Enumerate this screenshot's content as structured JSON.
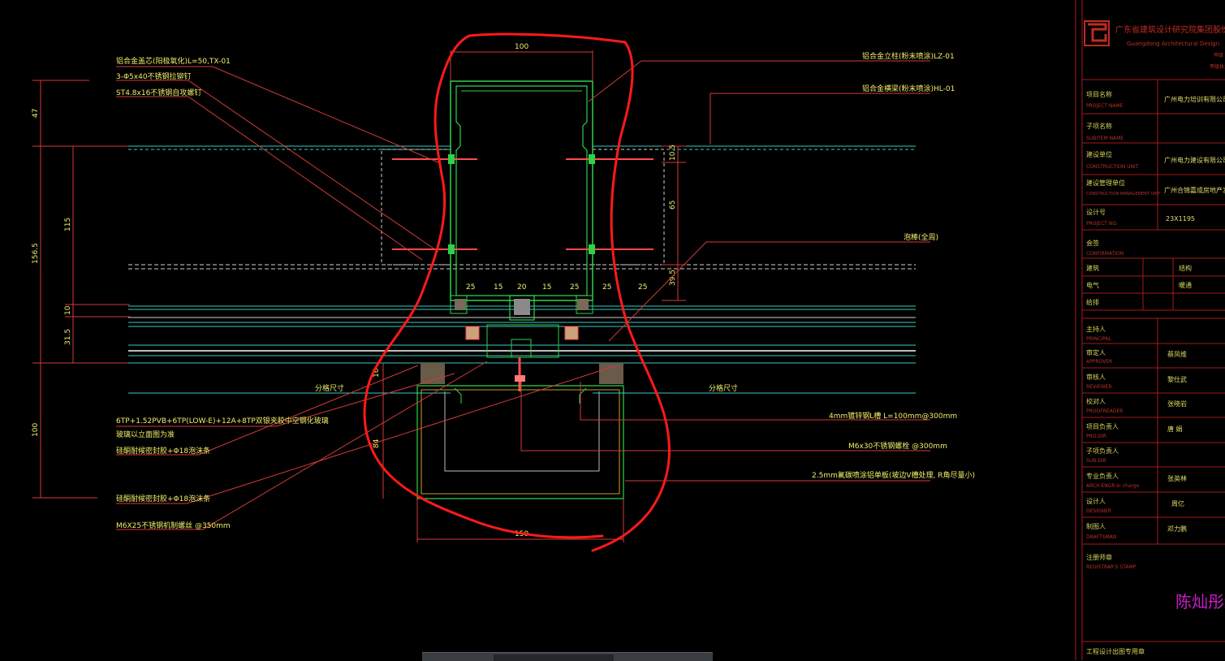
{
  "drawing": {
    "callouts_left": [
      "铝合金盖芯(阳极氧化)L=50,TX-01",
      "3-Φ5x40不锈钢拉铆钉",
      "ST4.8x16不锈钢自攻螺钉"
    ],
    "callouts_right_top": [
      "铝合金立柱(粉末喷涂)LZ-01",
      "铝合金横梁(粉末喷涂)HL-01",
      "泡棒(全周)"
    ],
    "callouts_left_bottom": [
      "6TP+1.52PVB+6TP(LOW-E)+12A+8TP双银夹胶中空钢化玻璃",
      "玻璃以立面图为准",
      "硅酮耐候密封胶+Φ18泡沫条",
      "硅酮耐候密封胶+Φ18泡沫条",
      "M6X25不锈钢机制螺丝 @350mm"
    ],
    "callouts_right_bottom": [
      "4mm镀锌钢L槽 L=100mm@300mm",
      "M6x30不锈钢螺栓 @300mm",
      "2.5mm氟碳喷涂铝单板(坡边V槽处理, R角尽量小)"
    ],
    "grid_labels": [
      "分格尺寸",
      "分格尺寸"
    ],
    "dims_left": [
      "47",
      "156.5",
      "115",
      "10",
      "31.5",
      "100"
    ],
    "dim_top": "100",
    "dims_bottom_row": [
      "25",
      "15",
      "20",
      "15",
      "25",
      "25",
      "25"
    ],
    "dims_right": [
      "10.5",
      "65",
      "39.5"
    ],
    "dim_16": "16",
    "dim_84": "84",
    "dim_150": "150"
  },
  "title_block": {
    "company_cn": "广东省建筑设计研究院集团股份",
    "company_en": "Guangdong Architectural Design",
    "company_sub1": "甲级",
    "company_sub2": "甲级执业证书",
    "rows": [
      {
        "cn": "项目名称",
        "en": "PROJECT NAME",
        "value": "广州电力培训有限公司电力机器"
      },
      {
        "cn": "子项名称",
        "en": "SUBITEM NAME",
        "value": ""
      },
      {
        "cn": "建设单位",
        "en": "CONSTRUCTION UNIT",
        "value": "广州电力建设有限公司"
      },
      {
        "cn": "建设管理单位",
        "en": "CONSTRUCTION MANAGEMENT UNIT",
        "value": "广州合锦嘉成房地产发"
      },
      {
        "cn": "设计号",
        "en": "PROJECT NO.",
        "value": "23X1195"
      }
    ],
    "confirm_cn": "会签",
    "confirm_en": "CONFIRMATION",
    "confirm_rows": [
      [
        "建筑",
        "结构"
      ],
      [
        "电气",
        "暖通"
      ],
      [
        "给排",
        ""
      ]
    ],
    "sign_rows": [
      {
        "cn": "主持人",
        "en": "PRINCIPAL",
        "value": ""
      },
      {
        "cn": "审定人",
        "en": "APPROVER",
        "value": "蔡凤维"
      },
      {
        "cn": "审核人",
        "en": "REVIEWER",
        "value": "黎仕武"
      },
      {
        "cn": "校对人",
        "en": "PROOFREADER",
        "value": "张晓岩"
      },
      {
        "cn": "项目负责人",
        "en": "PRO.DIR",
        "value": "唐  娟"
      },
      {
        "cn": "子项负责人",
        "en": "SUB.DIR",
        "value": ""
      },
      {
        "cn": "专业负责人",
        "en": "ARCH.ENGR.in charge",
        "value": "张英林"
      },
      {
        "cn": "设计人",
        "en": "DESIGNER",
        "value": "周亿"
      },
      {
        "cn": "制图人",
        "en": "DRAFTSMAN",
        "value": "邓力鹏"
      }
    ],
    "stamp_cn": "注册师章",
    "stamp_en": "REGISTRAR'S STAMP",
    "stamp_name": "陈灿彤结构",
    "footer": "工程设计出图专用章"
  },
  "colors": {
    "background": "#000000",
    "text_yellow": "#f2ee6a",
    "markup_red": "#ff1a1a",
    "profile_green": "#2fd24a",
    "line_cyan": "#37c9c2",
    "frame_red": "#a31a1a"
  }
}
